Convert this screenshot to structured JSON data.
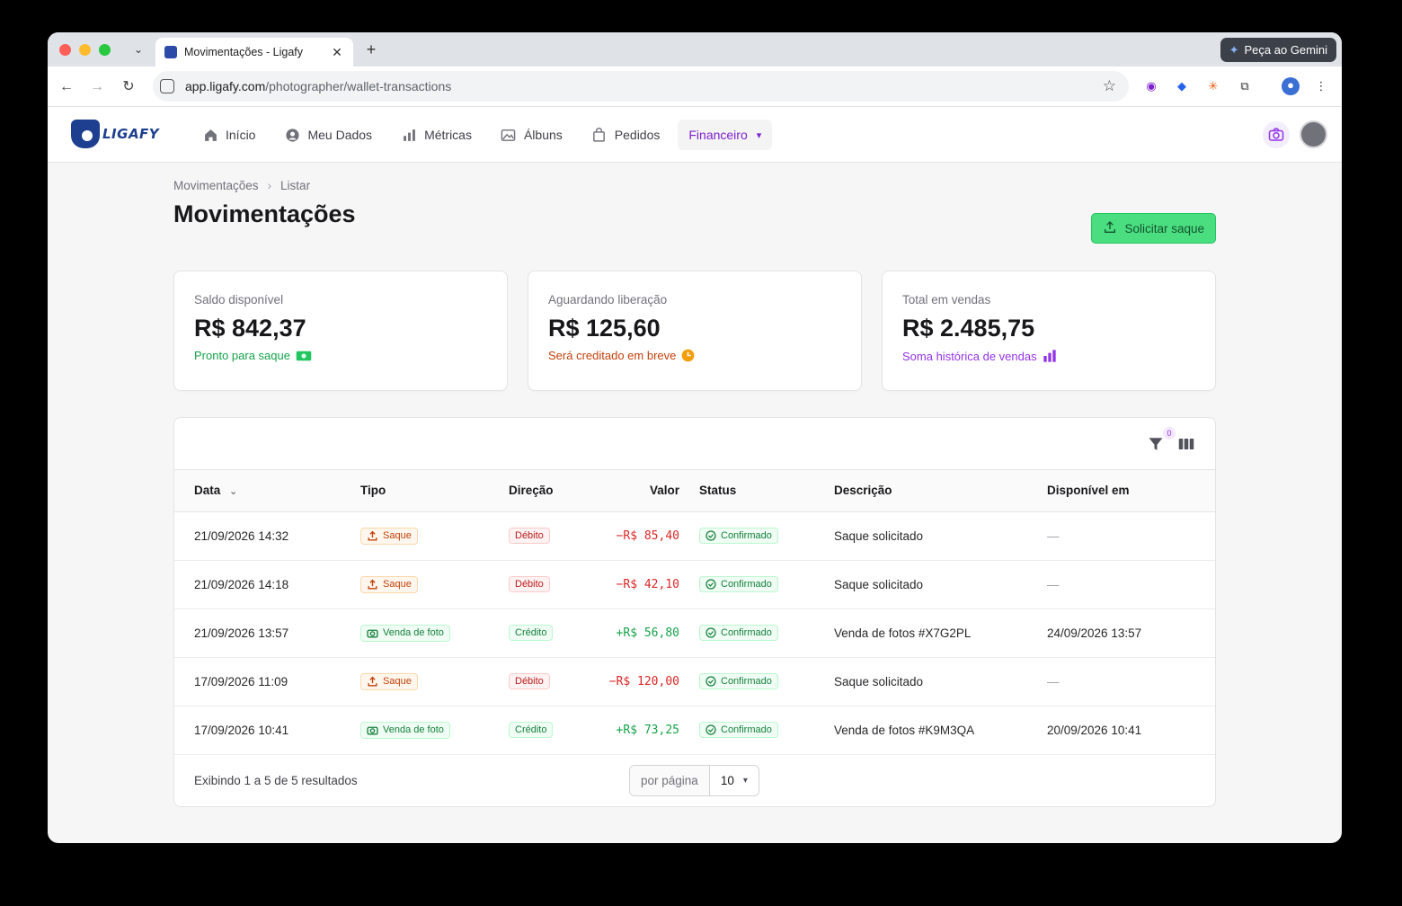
{
  "browser": {
    "tab_title": "Movimentações - Ligafy",
    "url_host": "app.ligafy.com",
    "url_path": "/photographer/wallet-transactions",
    "gemini_label": "Peça ao Gemini"
  },
  "app": {
    "logo_text": "LIGAFY",
    "nav": [
      {
        "label": "Início",
        "icon": "home-icon"
      },
      {
        "label": "Meu Dados",
        "icon": "user-circle-icon"
      },
      {
        "label": "Métricas",
        "icon": "bar-chart-icon"
      },
      {
        "label": "Álbuns",
        "icon": "image-icon"
      },
      {
        "label": "Pedidos",
        "icon": "shopping-bag-icon"
      },
      {
        "label": "Financeiro",
        "icon": "chevron-down-icon",
        "active": true
      }
    ]
  },
  "page": {
    "breadcrumb": [
      "Movimentações",
      "Listar"
    ],
    "title": "Movimentações",
    "withdraw_button": "Solicitar saque"
  },
  "cards": [
    {
      "label": "Saldo disponível",
      "value": "R$ 842,37",
      "note": "Pronto para saque",
      "note_color": "#16a34a",
      "icon": "money-icon"
    },
    {
      "label": "Aguardando liberação",
      "value": "R$ 125,60",
      "note": "Será creditado em breve",
      "note_color": "#c2410c",
      "icon": "clock-icon"
    },
    {
      "label": "Total em vendas",
      "value": "R$ 2.485,75",
      "note": "Soma histórica de vendas",
      "note_color": "#9333ea",
      "icon": "bar-chart-icon"
    }
  ],
  "table": {
    "filter_count": "0",
    "columns": [
      "Data",
      "Tipo",
      "Direção",
      "Valor",
      "Status",
      "Descrição",
      "Disponível em"
    ],
    "rows": [
      {
        "date": "21/09/2026 14:32",
        "type": "Saque",
        "direction": "Débito",
        "value": "−R$ 85,40",
        "status": "Confirmado",
        "description": "Saque solicitado",
        "available": "—"
      },
      {
        "date": "21/09/2026 14:18",
        "type": "Saque",
        "direction": "Débito",
        "value": "−R$ 42,10",
        "status": "Confirmado",
        "description": "Saque solicitado",
        "available": "—"
      },
      {
        "date": "21/09/2026 13:57",
        "type": "Venda de foto",
        "direction": "Crédito",
        "value": "+R$ 56,80",
        "status": "Confirmado",
        "description": "Venda de fotos #X7G2PL",
        "available": "24/09/2026 13:57"
      },
      {
        "date": "17/09/2026 11:09",
        "type": "Saque",
        "direction": "Débito",
        "value": "−R$ 120,00",
        "status": "Confirmado",
        "description": "Saque solicitado",
        "available": "—"
      },
      {
        "date": "17/09/2026 10:41",
        "type": "Venda de foto",
        "direction": "Crédito",
        "value": "+R$ 73,25",
        "status": "Confirmado",
        "description": "Venda de fotos #K9M3QA",
        "available": "20/09/2026 10:41"
      }
    ],
    "footer_text": "Exibindo 1 a 5 de 5 resultados",
    "per_page_label": "por página",
    "per_page_value": "10"
  }
}
